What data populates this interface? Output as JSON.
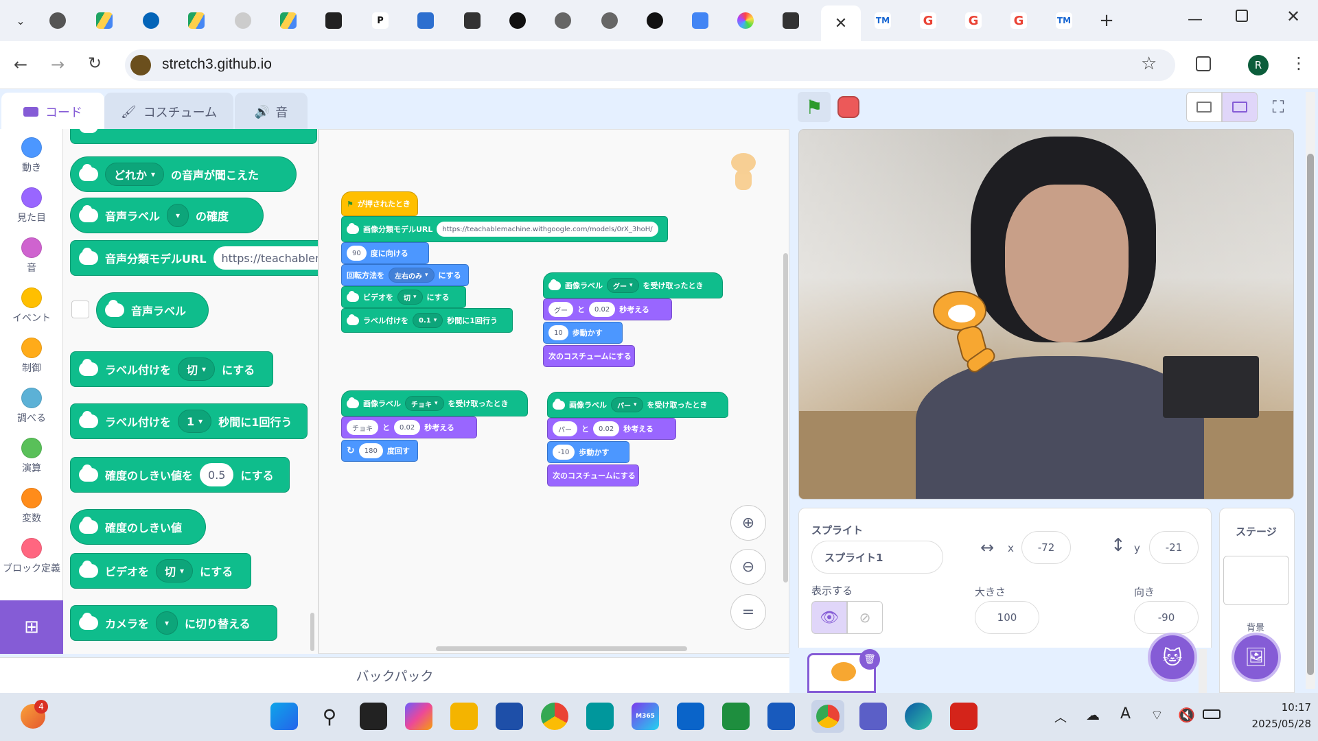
{
  "browser": {
    "url": "stretch3.github.io",
    "profile_initial": "R",
    "active_tab_close": "✕",
    "new_tab": "+",
    "tab_favicons": [
      "chromium",
      "drive",
      "onedrive",
      "drive",
      "drive-shortcut",
      "drive",
      "scratch-mask",
      "p",
      "contact",
      "contact-dark",
      "github",
      "globe",
      "globe",
      "github",
      "translate",
      "colorwheel",
      "contact-dark",
      "tm",
      "google",
      "google",
      "google",
      "tm"
    ]
  },
  "editor_tabs": {
    "code": "コード",
    "costume": "コスチューム",
    "sound": "音"
  },
  "categories": [
    {
      "label": "動き",
      "color": "#4c97ff"
    },
    {
      "label": "見た目",
      "color": "#9966ff"
    },
    {
      "label": "音",
      "color": "#cf63cf"
    },
    {
      "label": "イベント",
      "color": "#ffbf00"
    },
    {
      "label": "制御",
      "color": "#ffab19"
    },
    {
      "label": "調べる",
      "color": "#5cb1d6"
    },
    {
      "label": "演算",
      "color": "#59c059"
    },
    {
      "label": "変数",
      "color": "#ff8c1a"
    },
    {
      "label": "ブロック定義",
      "color": "#ff6680"
    }
  ],
  "palette": {
    "b1_dd": "どれか",
    "b1_text": "の音声が聞こえた",
    "b2_text": "音声ラベル",
    "b2_tail": "の確度",
    "b3_text": "音声分類モデルURL",
    "b3_input": "https://teachablem",
    "b4_text": "音声ラベル",
    "b5_text": "ラベル付けを",
    "b5_dd": "切",
    "b5_tail": "にする",
    "b6_text": "ラベル付けを",
    "b6_dd": "1",
    "b6_tail": "秒間に1回行う",
    "b7_text": "確度のしきい値を",
    "b7_input": "0.5",
    "b7_tail": "にする",
    "b8_text": "確度のしきい値",
    "b9_text": "ビデオを",
    "b9_dd": "切",
    "b9_tail": "にする",
    "b10_text": "カメラを",
    "b10_tail": "に切り替える"
  },
  "script1": {
    "hat": "が押されたとき",
    "url_label": "画像分類モデルURL",
    "url_value": "https://teachablemachine.withgoogle.com/models/0rX_3hoH/",
    "dir_value": "90",
    "dir_label": "度に向ける",
    "rot_label": "回転方法を",
    "rot_value": "左右のみ",
    "rot_tail": "にする",
    "video_label": "ビデオを",
    "video_value": "切",
    "video_tail": "にする",
    "interval_label": "ラベル付けを",
    "interval_value": "0.1",
    "interval_tail": "秒間に1回行う"
  },
  "script_goo": {
    "hat_label": "画像ラベル",
    "hat_value": "グー",
    "hat_tail": "を受け取ったとき",
    "say_value": "グー",
    "say_and": "と",
    "say_secs": "0.02",
    "say_tail": "秒考える",
    "move_value": "10",
    "move_tail": "歩動かす",
    "next": "次のコスチュームにする"
  },
  "script_choki": {
    "hat_label": "画像ラベル",
    "hat_value": "チョキ",
    "hat_tail": "を受け取ったとき",
    "say_value": "チョキ",
    "say_and": "と",
    "say_secs": "0.02",
    "say_tail": "秒考える",
    "turn_value": "180",
    "turn_tail": "度回す"
  },
  "script_paa": {
    "hat_label": "画像ラベル",
    "hat_value": "パー",
    "hat_tail": "を受け取ったとき",
    "say_value": "パー",
    "say_and": "と",
    "say_secs": "0.02",
    "say_tail": "秒考える",
    "move_value": "-10",
    "move_tail": "歩動かす",
    "next": "次のコスチュームにする"
  },
  "backpack": "バックパック",
  "sprite_panel": {
    "title": "スプライト",
    "name": "スプライト1",
    "x_label": "x",
    "x": "-72",
    "y_label": "y",
    "y": "-21",
    "show_label": "表示する",
    "size_label": "大きさ",
    "size": "100",
    "direction_label": "向き",
    "direction": "-90"
  },
  "stage_panel": {
    "title": "ステージ",
    "backdrop_label": "背景"
  },
  "taskbar": {
    "time": "10:17",
    "date": "2025/05/28",
    "badge": "4",
    "m365": "M365"
  }
}
